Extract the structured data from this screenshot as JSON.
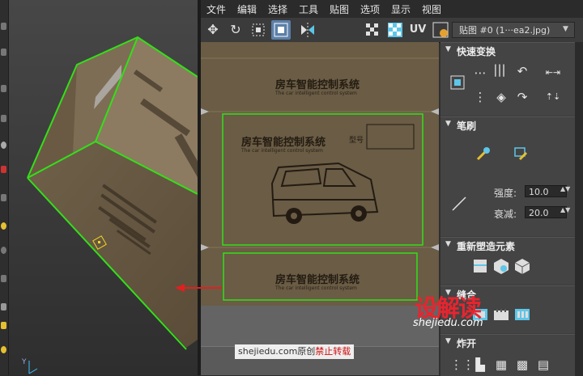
{
  "menubar": {
    "items": [
      "文件",
      "编辑",
      "选择",
      "工具",
      "贴图",
      "选项",
      "显示",
      "视图"
    ]
  },
  "toolbar": {
    "uv_label": "UV",
    "map_select": "贴图 #0 (1···ea2.jpg)"
  },
  "texture": {
    "title_top": "房车智能控制系统",
    "subtitle_top": "The car intelligent control system",
    "title_mid": "房车智能控制系统",
    "subtitle_mid": "The car intelligent control system",
    "label_box": "型号",
    "title_bottom": "房车智能控制系统",
    "subtitle_bottom": "The car intelligent control system"
  },
  "panel": {
    "quick_transform": {
      "title": "快速变换"
    },
    "brush": {
      "title": "笔刷",
      "strength_label": "强度:",
      "strength_value": "10.0",
      "falloff_label": "衰减:",
      "falloff_value": "20.0"
    },
    "reshape": {
      "title": "重新塑造元素"
    },
    "stitch": {
      "title": "缝合"
    },
    "explode": {
      "title": "炸开"
    }
  },
  "watermark": {
    "site": "shejiedu.com",
    "logo": "设解读",
    "source_prefix": "shejiedu.com原创",
    "source_warning": "禁止转载"
  },
  "viewport": {
    "axis_label": "Y"
  },
  "colors": {
    "selection_green": "#33e018",
    "texture_brown": "#6a5c45",
    "accent_blue": "#5b7fa8",
    "arrow_red": "#e02020"
  }
}
